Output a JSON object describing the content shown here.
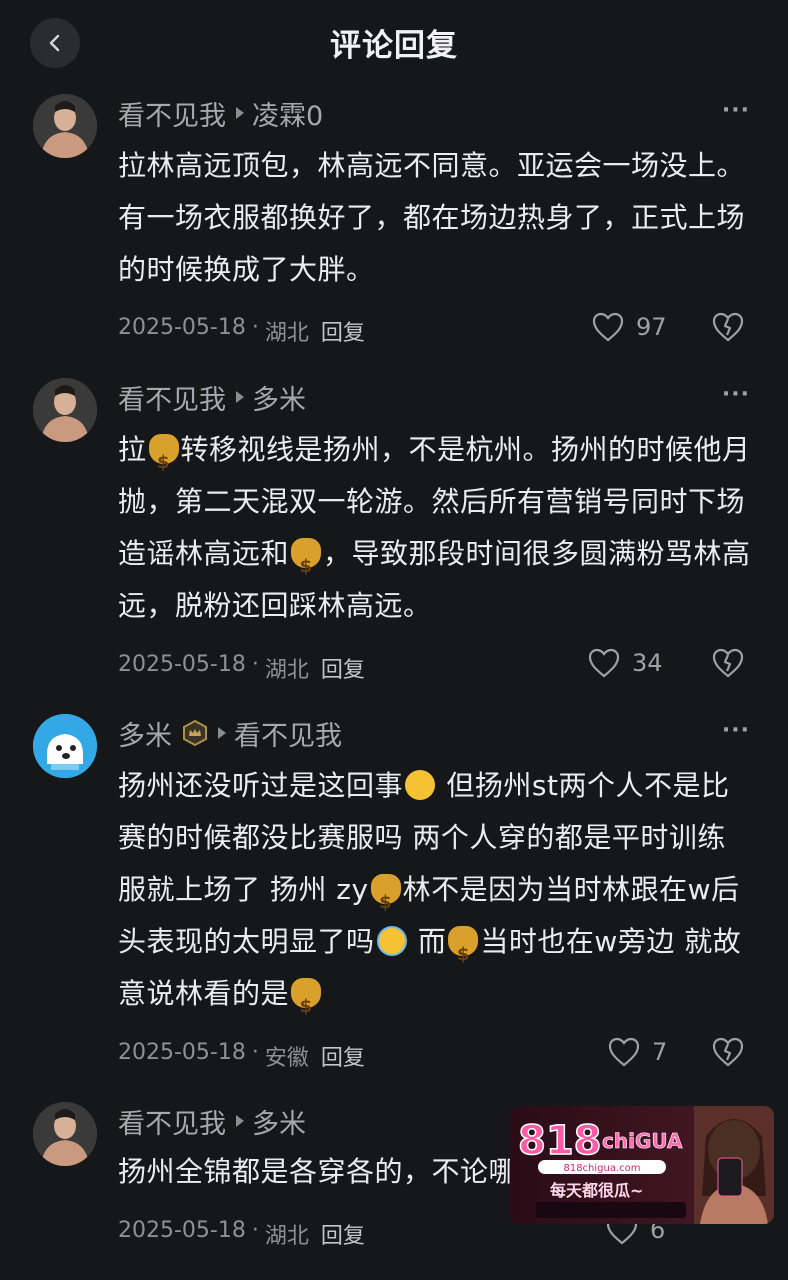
{
  "header": {
    "title": "评论回复"
  },
  "comments": [
    {
      "user": "看不见我",
      "reply_to": "凌霖0",
      "segments": [
        "拉林高远顶包，林高远不同意。亚运会一场没上。有一场衣服都换好了，都在场边热身了，正式上场的时候换成了大胖。"
      ],
      "date": "2025-05-18",
      "location": "湖北",
      "reply_label": "回复",
      "likes": "97"
    },
    {
      "user": "看不见我",
      "reply_to": "多米",
      "segments": [
        "拉",
        "转移视线是扬州，不是杭州。扬州的时候他月抛，第二天混双一轮游。然后所有营销号同时下场造谣林高远和",
        "，导致那段时间很多圆满粉骂林高远，脱粉还回踩林高远。"
      ],
      "date": "2025-05-18",
      "location": "湖北",
      "reply_label": "回复",
      "likes": "34"
    },
    {
      "user": "多米",
      "reply_to": "看不见我",
      "segments": [
        "扬州还没听过是这回事",
        " 但扬州st两个人不是比赛的时候都没比赛服吗  两个人穿的都是平时训练服就上场了  扬州 zy",
        "林不是因为当时林跟在w后头表现的太明显了吗",
        " 而",
        "当时也在w旁边   就故意说林看的是"
      ],
      "date": "2025-05-18",
      "location": "安徽",
      "reply_label": "回复",
      "likes": "7"
    },
    {
      "user": "看不见我",
      "reply_to": "多米",
      "segments": [
        "扬州全锦都是各穿各的，不论哪"
      ],
      "date": "2025-05-18",
      "location": "湖北",
      "reply_label": "回复",
      "likes": "6"
    }
  ],
  "icons": {
    "back": "chevron-left-icon",
    "more": "more-icon",
    "like": "heart-icon",
    "dislike": "broken-heart-icon",
    "emoji_money": "money-bag-emoji",
    "emoji_think": "thinking-face-emoji",
    "emoji_laughcry": "loudly-laughing-emoji"
  },
  "more_glyph": "···",
  "ad": {
    "brand": "818chiGUA",
    "url": "818chigua.com",
    "slogan": "每天都很瓜~"
  },
  "colors": {
    "background": "#161719",
    "text": "#ececee",
    "secondary": "#a7a8ad"
  }
}
